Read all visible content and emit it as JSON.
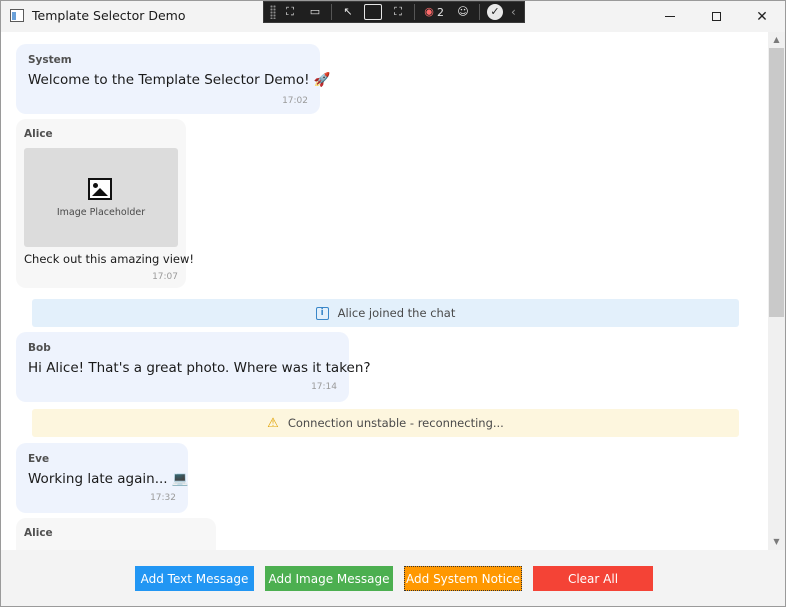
{
  "window": {
    "title": "Template Selector Demo"
  },
  "debug_toolbar": {
    "binding_failures": "2"
  },
  "messages": [
    {
      "sender": "System",
      "text": "Welcome to the Template Selector Demo! 🚀",
      "time": "17:02"
    },
    {
      "sender": "Alice",
      "image_caption": "Image Placeholder",
      "text": "Check out this amazing view!",
      "time": "17:07"
    },
    {
      "sender": "Bob",
      "text": "Hi Alice! That's a great photo. Where was it taken?",
      "time": "17:14"
    },
    {
      "sender": "Eve",
      "text": "Working late again... 💻",
      "time": "17:32"
    },
    {
      "sender": "Alice"
    }
  ],
  "notices": [
    {
      "type": "info",
      "text": "Alice joined the chat"
    },
    {
      "type": "warning",
      "text": "Connection unstable - reconnecting..."
    }
  ],
  "buttons": {
    "add_text": "Add Text Message",
    "add_image": "Add Image Message",
    "add_system": "Add System Notice",
    "clear_all": "Clear All"
  },
  "colors": {
    "add_text": "#2196F3",
    "add_image": "#4CAF50",
    "add_system": "#FF9800",
    "clear_all": "#F44336",
    "info_notice_bg": "#E3F0FB",
    "warning_notice_bg": "#FDF6DE"
  }
}
